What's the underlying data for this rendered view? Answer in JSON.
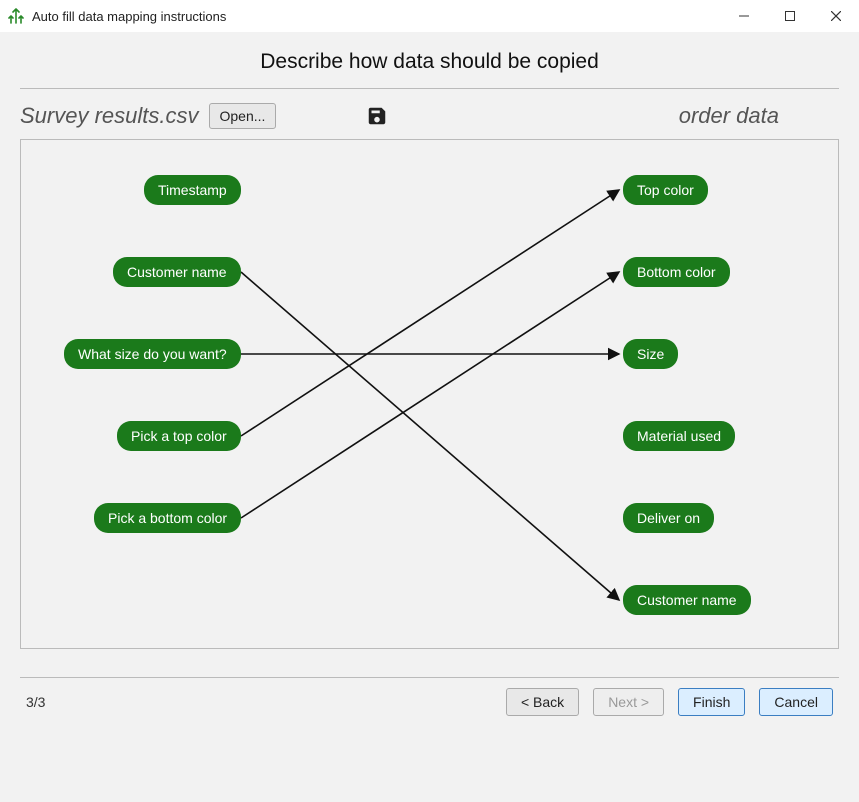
{
  "window": {
    "title": "Auto fill data mapping instructions"
  },
  "heading": "Describe how data should be copied",
  "source": {
    "filename": "Survey results.csv",
    "open_label": "Open..."
  },
  "target": {
    "name": "order data"
  },
  "mapping": {
    "source_fields": [
      {
        "id": "timestamp",
        "label": "Timestamp"
      },
      {
        "id": "customer_name",
        "label": "Customer name"
      },
      {
        "id": "what_size",
        "label": "What size do you want?"
      },
      {
        "id": "pick_top",
        "label": "Pick a top color"
      },
      {
        "id": "pick_bottom",
        "label": "Pick a bottom color"
      }
    ],
    "target_fields": [
      {
        "id": "top_color",
        "label": "Top color"
      },
      {
        "id": "bottom_color",
        "label": "Bottom color"
      },
      {
        "id": "size",
        "label": "Size"
      },
      {
        "id": "material_used",
        "label": "Material used"
      },
      {
        "id": "deliver_on",
        "label": "Deliver on"
      },
      {
        "id": "tgt_customer_name",
        "label": "Customer name"
      }
    ],
    "connections": [
      {
        "from": "customer_name",
        "to": "tgt_customer_name"
      },
      {
        "from": "what_size",
        "to": "size"
      },
      {
        "from": "pick_top",
        "to": "top_color"
      },
      {
        "from": "pick_bottom",
        "to": "bottom_color"
      }
    ]
  },
  "footer": {
    "page": "3/3",
    "back_label": "< Back",
    "next_label": "Next >",
    "finish_label": "Finish",
    "cancel_label": "Cancel"
  },
  "colors": {
    "pill_bg": "#1b7a1b"
  }
}
